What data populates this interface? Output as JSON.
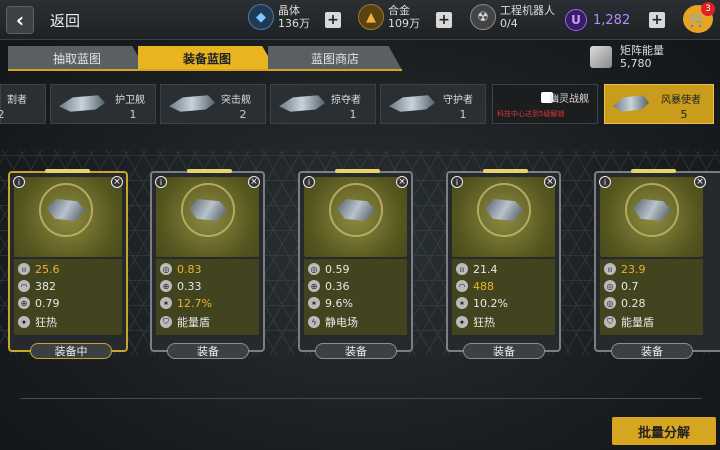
{
  "header": {
    "back_label": "返回",
    "resources": [
      {
        "name": "晶体",
        "value": "136万",
        "icon": "crystal-icon"
      },
      {
        "name": "合金",
        "value": "109万",
        "icon": "alloy-icon"
      },
      {
        "name": "工程机器人",
        "value": "0/4",
        "icon": "robot-icon"
      }
    ],
    "currency": {
      "symbol": "U",
      "value": "1,282"
    },
    "shop_badge": "3"
  },
  "tabs": [
    {
      "label": "抽取蓝图",
      "active": false
    },
    {
      "label": "装备蓝图",
      "active": true
    },
    {
      "label": "蓝图商店",
      "active": false
    }
  ],
  "matrix_energy": {
    "label": "矩阵能量",
    "value": "5,780"
  },
  "ships": [
    {
      "name": "割者",
      "count": "2"
    },
    {
      "name": "护卫舰",
      "count": "1"
    },
    {
      "name": "突击舰",
      "count": "2"
    },
    {
      "name": "掠夺者",
      "count": "1"
    },
    {
      "name": "守护者",
      "count": "1"
    },
    {
      "name": "幽灵战舰",
      "count": "",
      "locked": true,
      "hint": "科技中心达到5级解锁"
    },
    {
      "name": "风暴使者",
      "count": "5",
      "selected": true
    }
  ],
  "cards": [
    {
      "stats": [
        "25.6",
        "382",
        "0.79"
      ],
      "skill": "狂热",
      "button": "装备中",
      "equipped": true
    },
    {
      "stats": [
        "0.83",
        "0.33",
        "12.7%"
      ],
      "skill": "能量盾",
      "button": "装备",
      "equipped": false
    },
    {
      "stats": [
        "0.59",
        "0.36",
        "9.6%"
      ],
      "skill": "静电场",
      "button": "装备",
      "equipped": false
    },
    {
      "stats": [
        "21.4",
        "488",
        "10.2%"
      ],
      "skill": "狂热",
      "button": "装备",
      "equipped": false
    },
    {
      "stats": [
        "23.9",
        "0.7",
        "0.28"
      ],
      "skill": "能量盾",
      "button": "装备",
      "equipped": false
    }
  ],
  "batch_button": "批量分解",
  "colors": {
    "accent": "#e8b521",
    "highlight": "#f0b22a",
    "currency": "#b58cff"
  }
}
